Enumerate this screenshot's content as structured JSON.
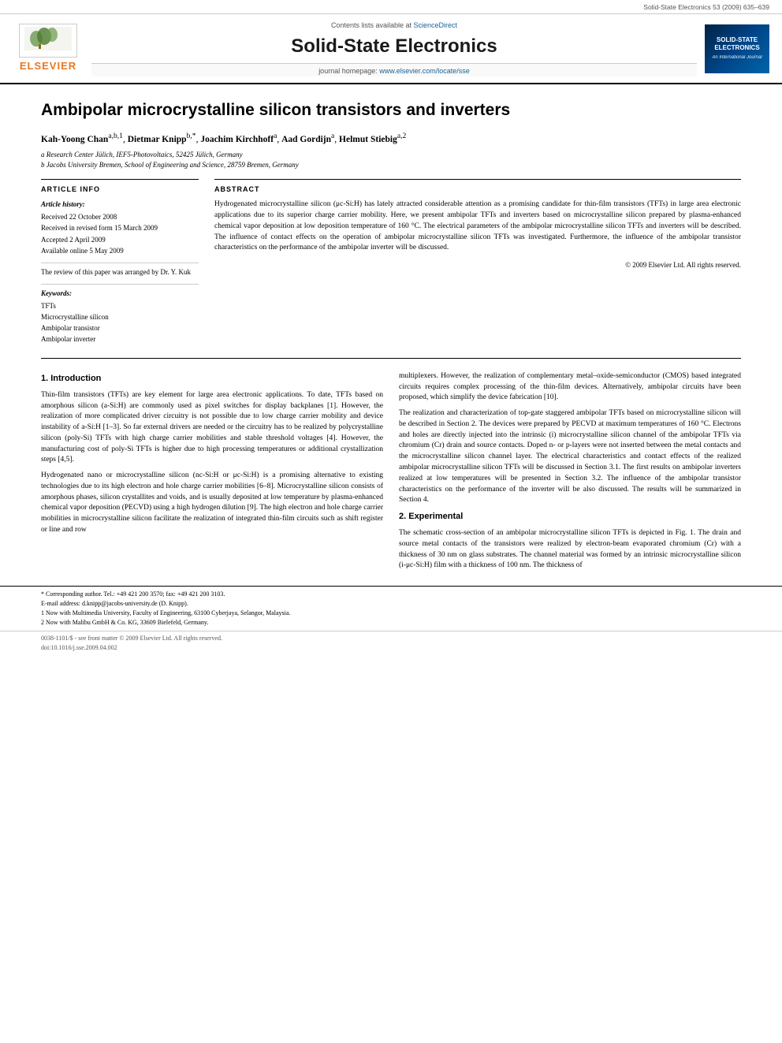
{
  "meta": {
    "journal_ref": "Solid-State Electronics 53 (2009) 635–639"
  },
  "header": {
    "contents_text": "Contents lists available at",
    "sciencedirect": "ScienceDirect",
    "journal_name": "Solid-State Electronics",
    "homepage_label": "journal homepage:",
    "homepage_url": "www.elsevier.com/locate/sse",
    "elsevier_label": "ELSEVIER",
    "sse_logo_line1": "SOLID-STATE",
    "sse_logo_line2": "ELECTRONICS",
    "sse_logo_sub": "An International Journal"
  },
  "article": {
    "title": "Ambipolar microcrystalline silicon transistors and inverters",
    "authors": "Kah-Yoong Chan a,b,1, Dietmar Knipp b,*, Joachim Kirchhoff a, Aad Gordijn a, Helmut Stiebig a,2",
    "affil_a": "a Research Center Jülich, IEF5-Photovoltaics, 52425 Jülich, Germany",
    "affil_b": "b Jacobs University Bremen, School of Engineering and Science, 28759 Bremen, Germany"
  },
  "article_info": {
    "section_label": "ARTICLE INFO",
    "history_label": "Article history:",
    "received": "Received 22 October 2008",
    "received_revised": "Received in revised form 15 March 2009",
    "accepted": "Accepted 2 April 2009",
    "available": "Available online 5 May 2009",
    "reviewer_note": "The review of this paper was arranged by Dr. Y. Kuk",
    "keywords_label": "Keywords:",
    "keyword1": "TFTs",
    "keyword2": "Microcrystalline silicon",
    "keyword3": "Ambipolar transistor",
    "keyword4": "Ambipolar inverter"
  },
  "abstract": {
    "section_label": "ABSTRACT",
    "text": "Hydrogenated microcrystalline silicon (μc-Si:H) has lately attracted considerable attention as a promising candidate for thin-film transistors (TFTs) in large area electronic applications due to its superior charge carrier mobility. Here, we present ambipolar TFTs and inverters based on microcrystalline silicon prepared by plasma-enhanced chemical vapor deposition at low deposition temperature of 160 °C. The electrical parameters of the ambipolar microcrystalline silicon TFTs and inverters will be described. The influence of contact effects on the operation of ambipolar microcrystalline silicon TFTs was investigated. Furthermore, the influence of the ambipolar transistor characteristics on the performance of the ambipolar inverter will be discussed.",
    "copyright": "© 2009 Elsevier Ltd. All rights reserved."
  },
  "section1": {
    "title": "1. Introduction",
    "para1": "Thin-film transistors (TFTs) are key element for large area electronic applications. To date, TFTs based on amorphous silicon (a-Si:H) are commonly used as pixel switches for display backplanes [1]. However, the realization of more complicated driver circuitry is not possible due to low charge carrier mobility and device instability of a-Si:H [1–3]. So far external drivers are needed or the circuitry has to be realized by polycrystalline silicon (poly-Si) TFTs with high charge carrier mobilities and stable threshold voltages [4]. However, the manufacturing cost of poly-Si TFTs is higher due to high processing temperatures or additional crystallization steps [4,5].",
    "para2": "Hydrogenated nano or microcrystalline silicon (nc-Si:H or μc-Si:H) is a promising alternative to existing technologies due to its high electron and hole charge carrier mobilities [6–8]. Microcrystalline silicon consists of amorphous phases, silicon crystallites and voids, and is usually deposited at low temperature by plasma-enhanced chemical vapor deposition (PECVD) using a high hydrogen dilution [9]. The high electron and hole charge carrier mobilities in microcrystalline silicon facilitate the realization of integrated thin-film circuits such as shift register or line and row"
  },
  "section1_right": {
    "para1": "multiplexers. However, the realization of complementary metal–oxide-semiconductor (CMOS) based integrated circuits requires complex processing of the thin-film devices. Alternatively, ambipolar circuits have been proposed, which simplify the device fabrication [10].",
    "para2": "The realization and characterization of top-gate staggered ambipolar TFTs based on microcrystalline silicon will be described in Section 2. The devices were prepared by PECVD at maximum temperatures of 160 °C. Electrons and holes are directly injected into the intrinsic (i) microcrystalline silicon channel of the ambipolar TFTs via chromium (Cr) drain and source contacts. Doped n- or p-layers were not inserted between the metal contacts and the microcrystalline silicon channel layer. The electrical characteristics and contact effects of the realized ambipolar microcrystalline silicon TFTs will be discussed in Section 3.1. The first results on ambipolar inverters realized at low temperatures will be presented in Section 3.2. The influence of the ambipolar transistor characteristics on the performance of the inverter will be also discussed. The results will be summarized in Section 4."
  },
  "section2": {
    "title": "2. Experimental",
    "para1": "The schematic cross-section of an ambipolar microcrystalline silicon TFTs is depicted in Fig. 1. The drain and source metal contacts of the transistors were realized by electron-beam evaporated chromium (Cr) with a thickness of 30 nm on glass substrates. The channel material was formed by an intrinsic microcrystalline silicon (i-μc-Si:H) film with a thickness of 100 nm. The thickness of"
  },
  "footer": {
    "corresponding_note": "* Corresponding author. Tel.: +49 421 200 3570; fax: +49 421 200 3103.",
    "email_note": "E-mail address: d.knipp@jacobs-university.de (D. Knipp).",
    "footnote1": "1 Now with Multimedia University, Faculty of Engineering, 63100 Cyberjaya, Selangor, Malaysia.",
    "footnote2": "2 Now with Malibu GmbH & Co. KG, 33609 Bielefeld, Germany.",
    "issn_note": "0038-1101/$ - see front matter © 2009 Elsevier Ltd. All rights reserved.",
    "doi_note": "doi:10.1016/j.sse.2009.04.002"
  }
}
